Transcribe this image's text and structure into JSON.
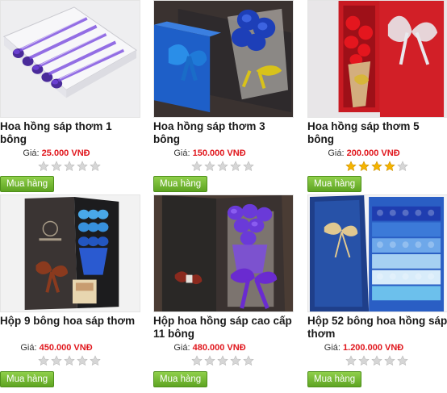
{
  "products": [
    {
      "name": "Hoa hồng sáp thơm 1 bông",
      "price_label": "Giá:",
      "price": "25.000 VNĐ",
      "rating": 0,
      "buy_label": "Mua hàng",
      "image": "purple-roses-tray"
    },
    {
      "name": "Hoa hồng sáp thơm 3 bông",
      "price_label": "Giá:",
      "price": "150.000 VNĐ",
      "rating": 0,
      "buy_label": "Mua hàng",
      "image": "blue-roses-box"
    },
    {
      "name": "Hoa hồng sáp thơm 5 bông",
      "price_label": "Giá:",
      "price": "200.000 VNĐ",
      "rating": 4,
      "buy_label": "Mua hàng",
      "image": "red-roses-box"
    },
    {
      "name": "Hộp 9 bông hoa sáp thơm",
      "price_label": "Giá:",
      "price": "450.000 VNĐ",
      "rating": 0,
      "buy_label": "Mua hàng",
      "image": "blue-roses-gift-box"
    },
    {
      "name": "Hộp hoa hồng sáp cao cấp 11 bông",
      "price_label": "Giá:",
      "price": "480.000 VNĐ",
      "rating": 0,
      "buy_label": "Mua hàng",
      "image": "purple-roses-gift-box"
    },
    {
      "name": "Hộp 52 bông hoa hồng sáp thơm",
      "price_label": "Giá:",
      "price": "1.200.000 VNĐ",
      "rating": 0,
      "buy_label": "Mua hàng",
      "image": "gradient-roses-box"
    }
  ],
  "colors": {
    "price": "#e0161c",
    "button": "#6cb22e",
    "star_on": "#f5b400",
    "star_off": "#d6d6d6"
  }
}
